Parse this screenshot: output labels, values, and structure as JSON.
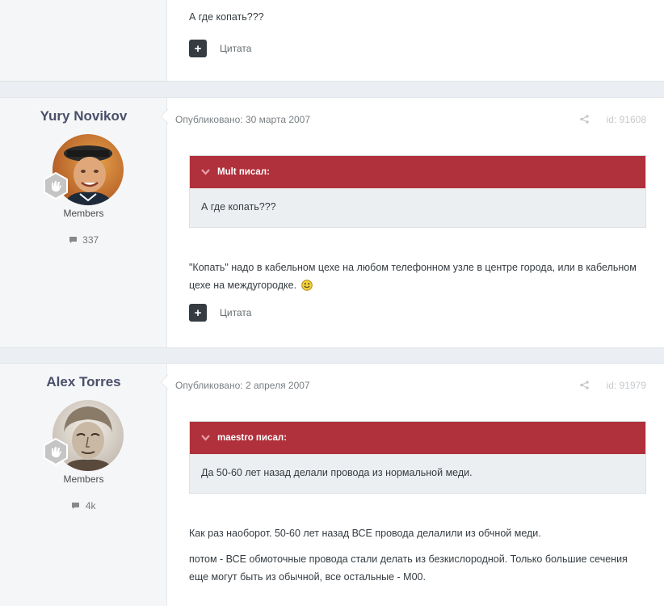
{
  "posts": [
    {
      "text": [
        "А где копать???"
      ],
      "quote_button": "Цитата"
    },
    {
      "author": "Yury Novikov",
      "group": "Members",
      "count": "337",
      "meta": "Опубликовано: 30 марта 2007",
      "post_id": "id: 91608",
      "quote": {
        "head": "Mult писал:",
        "body": "А где копать???"
      },
      "text": [
        "\"Копать\" надо в кабельном цехе на любом телефонном узле в центре города, или в кабельном цехе на междугородке."
      ],
      "quote_button": "Цитата"
    },
    {
      "author": "Alex Torres",
      "group": "Members",
      "count": "4k",
      "meta": "Опубликовано: 2 апреля 2007",
      "post_id": "id: 91979",
      "quote": {
        "head": "maestro писал:",
        "body": "Да 50-60 лет назад делали провода из нормальной меди."
      },
      "text": [
        "Как раз наоборот. 50-60 лет назад ВСЕ провода делалили из обчной меди.",
        "потом - ВСЕ обмоточные провода стали делать из безкислородной. Только большие сечения еще могут быть из обычной, все остальные - М00."
      ]
    }
  ],
  "icons": {
    "plus": "plus-icon",
    "share": "share-icon",
    "chat": "chat-bubble-icon",
    "quote_toggle": "chevron-down-icon",
    "smile": "smiley-icon",
    "rank": "rank-badge-icon"
  },
  "colors": {
    "quote_header": "#b0303b",
    "author_name": "#4a4f6a",
    "button": "#353c41",
    "author_panel": "#f5f6f7"
  }
}
